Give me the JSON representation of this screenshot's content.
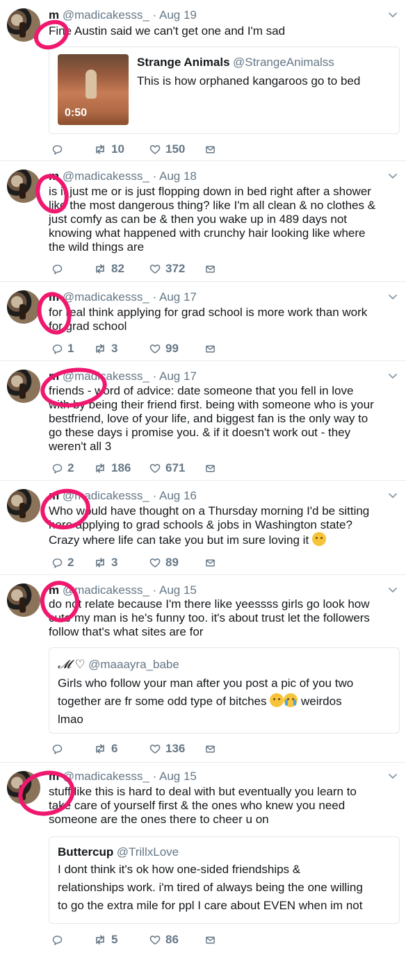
{
  "tweets": [
    {
      "display_name": "m",
      "handle": "@madicakesss_",
      "date": "· Aug 19",
      "text": "Fine Austin said we can't get one and I'm sad",
      "quote": {
        "name": "Strange Animals",
        "handle": "@StrangeAnimalss",
        "text": "This is how orphaned kangaroos go to bed",
        "video_duration": "0:50"
      },
      "replies": "",
      "retweets": "10",
      "likes": "150"
    },
    {
      "display_name": "m",
      "handle": "@madicakesss_",
      "date": "· Aug 18",
      "text_lines": [
        "is it just me or is just flopping down in bed right after a shower",
        "like the most dangerous thing? like I'm all clean & no clothes &",
        "just comfy as can be & then you wake up in 489 days not",
        "knowing what happened with crunchy hair looking like where",
        "the wild things are"
      ],
      "replies": "",
      "retweets": "82",
      "likes": "372"
    },
    {
      "display_name": "m",
      "handle": "@madicakesss_",
      "date": "· Aug 17",
      "text_lines": [
        "for real think applying for grad school is more work than work",
        "for grad school"
      ],
      "replies": "1",
      "retweets": "3",
      "likes": "99"
    },
    {
      "display_name": "m",
      "handle": "@madicakesss_",
      "date": "· Aug 17",
      "text_lines": [
        "friends - word of advice: date someone that you fell in love",
        "with by being their friend first. being with someone who is your",
        "bestfriend, love of your life, and biggest fan is the only way to",
        "go these days i promise you. & if it doesn't work out - they",
        "weren't all 3"
      ],
      "replies": "2",
      "retweets": "186",
      "likes": "671"
    },
    {
      "display_name": "m",
      "handle": "@madicakesss_",
      "date": "· Aug 16",
      "text_lines": [
        "Who would have thought on a Thursday morning I'd be sitting",
        "here applying to grad schools & jobs in Washington state?",
        "Crazy where life can take you but im sure loving it"
      ],
      "emoji": "hugging-face",
      "replies": "2",
      "retweets": "3",
      "likes": "89"
    },
    {
      "display_name": "m",
      "handle": "@madicakesss_",
      "date": "· Aug 15",
      "text_lines": [
        "do not relate because I'm there like yeessss girls go look how",
        "cute my man is he's funny too. it's about trust let the followers",
        "follow that's what sites are for"
      ],
      "quote": {
        "name": "𝓜 ♡",
        "handle": "@maaayra_babe",
        "text_lines": [
          "Girls who follow your man after you post a pic of you two",
          "together are fr some odd type of bitches",
          "lmao"
        ],
        "tail_word": "weirdos"
      },
      "replies": "",
      "retweets": "6",
      "likes": "136"
    },
    {
      "display_name": "m",
      "handle": "@madicakesss_",
      "date": "· Aug 15",
      "text_lines": [
        "stuff like this is hard to deal with but eventually you learn to",
        "take care of yourself first & the ones who knew you need",
        "someone are the ones there to cheer u on"
      ],
      "quote": {
        "name": "Buttercup",
        "handle": "@TrillxLove",
        "text_lines": [
          "I dont think it's ok how one-sided friendships &",
          "relationships work. i'm tired of always being the one willing",
          "to go the extra mile for ppl I care about EVEN when im not"
        ]
      },
      "replies": "",
      "retweets": "5",
      "likes": "86"
    }
  ],
  "colors": {
    "muted": "#657786",
    "border": "#e6ecf0",
    "annotation": "#f0186e"
  }
}
